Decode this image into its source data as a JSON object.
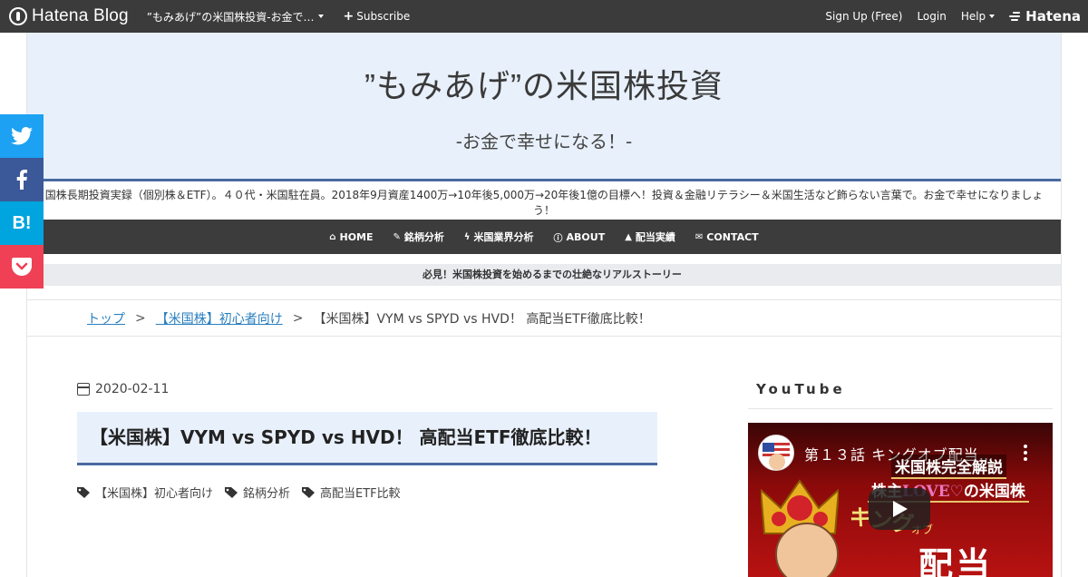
{
  "topbar": {
    "logo": "Hatena Blog",
    "blog_name": "”もみあげ”の米国株投資-お金で…",
    "subscribe": "Subscribe",
    "signup": "Sign Up (Free)",
    "login": "Login",
    "help": "Help",
    "hatena": "Hatena"
  },
  "header": {
    "title": "”もみあげ”の米国株投資",
    "subtitle": "-お金で幸せになる！-",
    "description": "国株長期投資実録（個別株＆ETF）。４０代・米国駐在員。2018年9月資産1400万→10年後5,000万→20年後1億の目標へ！投資＆金融リテラシー＆米国生活など飾らない言葉で。お金で幸せになりましょう！",
    "colors": {
      "header_bg": "#e8f0fb",
      "accent": "#4a6aa0",
      "nav_bg": "#3c3c3c"
    }
  },
  "nav": {
    "items": [
      {
        "icon": "home-icon",
        "label": "HOME"
      },
      {
        "icon": "wrench-icon",
        "label": "銘柄分析"
      },
      {
        "icon": "bolt-icon",
        "label": "米国業界分析"
      },
      {
        "icon": "info-icon",
        "label": "ABOUT"
      },
      {
        "icon": "graduation-cap-icon",
        "label": "配当実績"
      },
      {
        "icon": "envelope-icon",
        "label": "CONTACT"
      }
    ]
  },
  "notice": "必見！米国株投資を始めるまでの壮絶なリアルストーリー",
  "breadcrumb": {
    "top": "トップ",
    "separator": ">",
    "category": "【米国株】初心者向け",
    "current": "【米国株】VYM vs SPYD vs HVD！ 高配当ETF徹底比較！"
  },
  "article": {
    "date": "2020-02-11",
    "title": "【米国株】VYM vs SPYD vs HVD！ 高配当ETF徹底比較！",
    "categories": [
      "【米国株】初心者向け",
      "銘柄分析",
      "高配当ETF比較"
    ]
  },
  "sidebar": {
    "youtube_heading": "YouTube",
    "video": {
      "title": "第１３話 キングオブ配当…",
      "line1": "米国株完全解説",
      "line2_pre": "株主",
      "line2_love": "LOVE",
      "line2_heart": "♡",
      "line2_post": "の米国株",
      "king": "キング",
      "of": "オブ",
      "haito": "配当"
    }
  },
  "share": {
    "twitter_icon": "twitter-icon",
    "facebook_icon": "facebook-icon",
    "hatebu_label": "B!",
    "pocket_icon": "pocket-icon",
    "colors": {
      "twitter": "#1da1f2",
      "facebook": "#3b5998",
      "hatebu": "#00a4de",
      "pocket": "#ef4056"
    }
  }
}
